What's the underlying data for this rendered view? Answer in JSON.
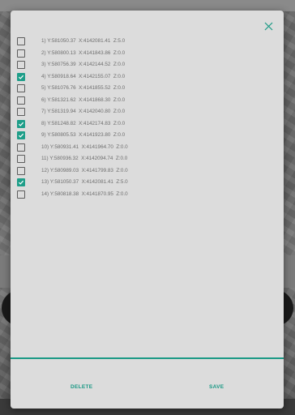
{
  "dialog": {
    "points": [
      {
        "label": "1) Y:581050.37  X:4142081.41  Z:5.0",
        "checked": false
      },
      {
        "label": "2) Y:580800.13  X:4141843.86  Z:0.0",
        "checked": false
      },
      {
        "label": "3) Y:580756.39  X:4142144.52  Z:0.0",
        "checked": false
      },
      {
        "label": "4) Y:580918.64  X:4142155.07  Z:0.0",
        "checked": true
      },
      {
        "label": "5) Y:581076.76  X:4141855.52  Z:0.0",
        "checked": false
      },
      {
        "label": "6) Y:581321.62  X:4141868.30  Z:0.0",
        "checked": false
      },
      {
        "label": "7) Y:581319.94  X:4142040.80  Z:0.0",
        "checked": false
      },
      {
        "label": "8) Y:581248.82  X:4142174.83  Z:0.0",
        "checked": true
      },
      {
        "label": "9) Y:580805.53  X:4141923.80  Z:0.0",
        "checked": true
      },
      {
        "label": "10) Y:580931.41  X:4141964.70  Z:0.0",
        "checked": false
      },
      {
        "label": "11) Y:580936.32  X:4142094.74  Z:0.0",
        "checked": false
      },
      {
        "label": "12) Y:580989.03  X:4141799.83  Z:0.0",
        "checked": false
      },
      {
        "label": "13) Y:581050.37  X:4142081.41  Z:5.0",
        "checked": true
      },
      {
        "label": "14) Y:580818.38  X:4141870.95  Z:0.0",
        "checked": false
      }
    ],
    "delete_label": "DELETE",
    "save_label": "SAVE",
    "close_icon": "close-icon"
  },
  "colors": {
    "accent": "#1a9985",
    "checkbox_checked": "#1e9e89",
    "dialog_bg": "#dcdcdc",
    "text": "#6e6e6e"
  }
}
